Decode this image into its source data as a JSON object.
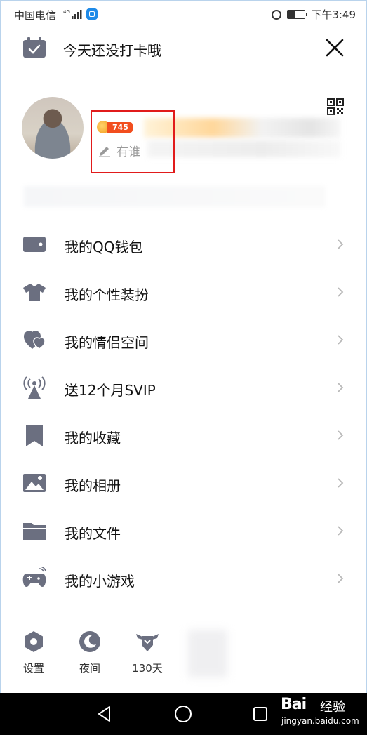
{
  "status_bar": {
    "carrier": "中国电信",
    "signal_label": "4G",
    "time": "下午3:49",
    "battery_level_percent": 45
  },
  "header": {
    "checkin_text": "今天还没打卡哦",
    "close_icon": "close-icon"
  },
  "profile": {
    "level_badge": "745",
    "signature_placeholder": "有谁"
  },
  "menu": {
    "items": [
      {
        "label": "我的QQ钱包",
        "icon": "wallet-icon"
      },
      {
        "label": "我的个性装扮",
        "icon": "shirt-icon"
      },
      {
        "label": "我的情侣空间",
        "icon": "hearts-icon"
      },
      {
        "label": "送12个月SVIP",
        "icon": "broadcast-tower-icon"
      },
      {
        "label": "我的收藏",
        "icon": "bookmark-icon"
      },
      {
        "label": "我的相册",
        "icon": "photo-icon"
      },
      {
        "label": "我的文件",
        "icon": "folder-icon"
      },
      {
        "label": "我的小游戏",
        "icon": "gamepad-icon"
      }
    ]
  },
  "bottom_tools": [
    {
      "label": "设置",
      "icon": "settings-icon"
    },
    {
      "label": "夜间",
      "icon": "moon-icon"
    },
    {
      "label": "130天",
      "icon": "winged-badge-icon"
    }
  ],
  "watermark": {
    "brand": "Bai",
    "brand_suffix": "经验",
    "url": "jingyan.baidu.com"
  },
  "colors": {
    "icon_gray": "#6b6f80",
    "level_badge_red": "#f24e1e",
    "highlight_box": "#e11b1b",
    "nav_bar": "#000000"
  }
}
